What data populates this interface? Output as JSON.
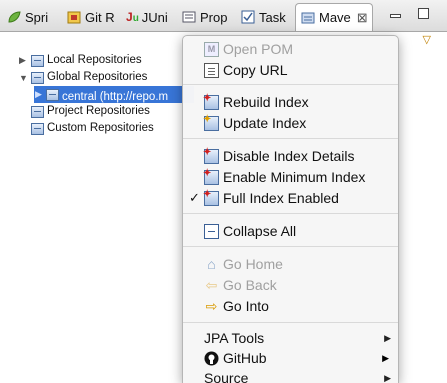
{
  "tabs": [
    {
      "label": "Spri",
      "icon": "spring-icon"
    },
    {
      "label": "Git R",
      "icon": "git-repo-icon"
    },
    {
      "label": "JUni",
      "icon": "junit-icon"
    },
    {
      "label": "Prop",
      "icon": "properties-icon"
    },
    {
      "label": "Task",
      "icon": "tasks-icon"
    },
    {
      "label": "Mave",
      "icon": "maven-repo-icon",
      "active": true,
      "close": "⊠"
    }
  ],
  "tree": [
    {
      "label": "Local Repositories",
      "expanded": false
    },
    {
      "label": "Global Repositories",
      "expanded": true
    },
    {
      "label": "central (http://repo.m",
      "selected": true
    },
    {
      "label": "Project Repositories"
    },
    {
      "label": "Custom Repositories"
    }
  ],
  "menu": {
    "items": [
      {
        "label": "Open POM",
        "disabled": true,
        "icon": "pom-icon"
      },
      {
        "label": "Copy URL",
        "icon": "copy-url-icon"
      },
      {
        "label": "Rebuild Index",
        "icon": "rebuild-index-icon"
      },
      {
        "label": "Update Index",
        "icon": "update-index-icon"
      },
      {
        "label": "Disable Index Details",
        "icon": "disable-index-icon"
      },
      {
        "label": "Enable Minimum Index",
        "icon": "minimum-index-icon"
      },
      {
        "label": "Full Index Enabled",
        "icon": "full-index-icon",
        "checked": true,
        "check_mark": "✓"
      },
      {
        "label": "Collapse All",
        "icon": "collapse-all-icon"
      },
      {
        "label": "Go Home",
        "disabled": true,
        "icon": "home-icon"
      },
      {
        "label": "Go Back",
        "disabled": true,
        "icon": "back-arrow-icon"
      },
      {
        "label": "Go Into",
        "icon": "forward-arrow-icon"
      },
      {
        "label": "JPA Tools",
        "submenu": true
      },
      {
        "label": "GitHub",
        "submenu": true,
        "icon": "github-icon"
      },
      {
        "label": "Source",
        "submenu": true
      }
    ]
  },
  "colors": {
    "selection": "#3875d7",
    "disabled_text": "#a0a0a0",
    "menu_bg": "#f6f6f6"
  }
}
